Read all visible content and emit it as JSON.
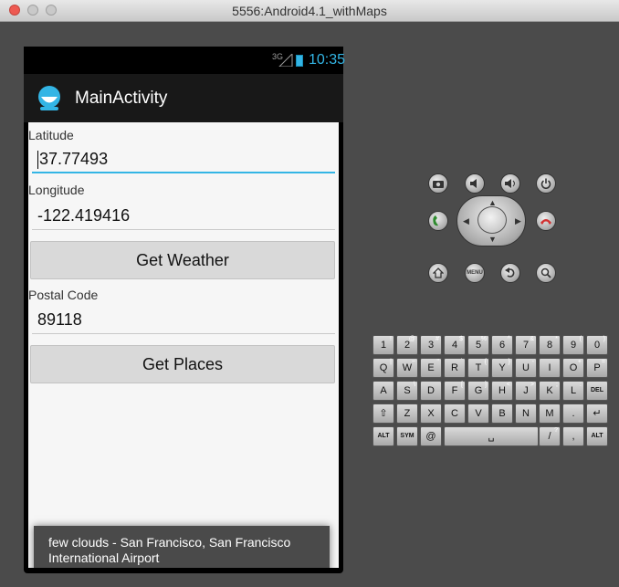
{
  "window": {
    "title": "5556:Android4.1_withMaps"
  },
  "status_bar": {
    "signal": "3G",
    "time": "10:35"
  },
  "action_bar": {
    "title": "MainActivity"
  },
  "form": {
    "latitude_label": "Latitude",
    "latitude_value": "37.77493",
    "longitude_label": "Longitude",
    "longitude_value": "-122.419416",
    "weather_button": "Get Weather",
    "postal_label": "Postal Code",
    "postal_value": "89118",
    "places_button": "Get Places"
  },
  "toast": {
    "text": "few clouds - San Francisco, San Francisco International Airport"
  },
  "controls": {
    "menu_label": "MENU"
  },
  "keyboard": {
    "row1": [
      [
        "1",
        "!"
      ],
      [
        "2",
        "@"
      ],
      [
        "3",
        "#"
      ],
      [
        "4",
        "$"
      ],
      [
        "5",
        "%"
      ],
      [
        "6",
        "^"
      ],
      [
        "7",
        "&"
      ],
      [
        "8",
        "*"
      ],
      [
        "9",
        "("
      ],
      [
        "0",
        ")"
      ]
    ],
    "row2": [
      [
        "Q",
        "|"
      ],
      [
        "W",
        "~"
      ],
      [
        "E",
        "\""
      ],
      [
        "R",
        "`"
      ],
      [
        "T",
        "{"
      ],
      [
        "Y",
        "}"
      ],
      [
        "U",
        "-"
      ],
      [
        "I",
        ""
      ],
      [
        "O",
        "+"
      ],
      [
        "P",
        "="
      ]
    ],
    "row3": [
      [
        "A",
        ""
      ],
      [
        "S",
        "\\"
      ],
      [
        "D",
        ""
      ],
      [
        "F",
        "["
      ],
      [
        "G",
        "]"
      ],
      [
        "H",
        "<"
      ],
      [
        "J",
        ">"
      ],
      [
        "K",
        ";"
      ],
      [
        "L",
        ":"
      ],
      [
        "DEL",
        ""
      ]
    ],
    "row4": [
      [
        "⇧",
        ""
      ],
      [
        "Z",
        ""
      ],
      [
        "X",
        ""
      ],
      [
        "C",
        ""
      ],
      [
        "V",
        ""
      ],
      [
        "B",
        ""
      ],
      [
        "N",
        ""
      ],
      [
        "M",
        ""
      ],
      [
        ".",
        ""
      ],
      [
        "↵",
        ""
      ]
    ],
    "row5": {
      "alt_left": "ALT",
      "sym": "SYM",
      "at": "@",
      "space": "␣",
      "slash": "/",
      "slash_sub": "?",
      "comma": ",",
      "alt_right": "ALT"
    }
  },
  "colors": {
    "accent": "#33b5e5",
    "close": "#ee5a52",
    "call": "#2e8b2e",
    "hangup": "#d23030"
  }
}
